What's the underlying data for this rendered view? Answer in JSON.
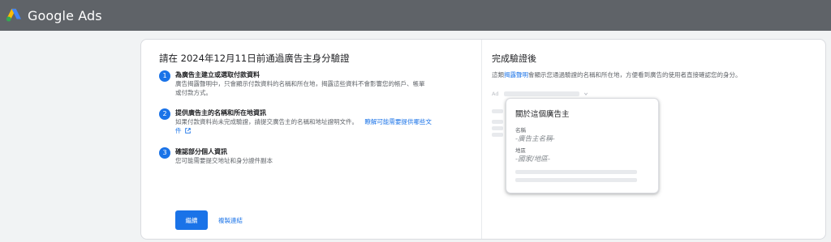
{
  "header": {
    "app_name": "Google Ads",
    "logo_icon": "google-ads-logo",
    "background": "#5f6368"
  },
  "left": {
    "title": "請在 2024年12月11日前通過廣告主身分驗證",
    "steps": [
      {
        "number": "1",
        "title": "為廣告主建立或選取付款資料",
        "desc_line1": "廣告揭露聲明中，只會顯示付款資料的名稱和所在地，揭露這些資料不會影響您的帳戶、帳單",
        "desc_line2": "或付款方式。"
      },
      {
        "number": "2",
        "title": "提供廣告主的名稱和所在地資訊",
        "desc": "如果付款資料尚未完成驗證，請提交廣告主的名稱和地址證明文件。",
        "link_line1": "瞭解可能需要提供哪些文",
        "link_line2": "件",
        "link_icon": "external-link-icon"
      },
      {
        "number": "3",
        "title": "確認部分個人資訊",
        "desc": "您可能需要提交地址和身分證件副本"
      }
    ],
    "continue_label": "繼續",
    "copy_link_label": "複製連結"
  },
  "right": {
    "title": "完成驗證後",
    "desc_prefix": "這類",
    "desc_link": "揭露聲明",
    "desc_suffix": "會顯示您通過驗證的名稱和所在地，方便看到廣告的使用者直接確認您的身分。",
    "ad_label": "Ad",
    "popup": {
      "title": "關於這個廣告主",
      "name_label": "名稱",
      "name_value": "-廣告主名稱-",
      "region_label": "地區",
      "region_value": "-國家/地區-"
    }
  },
  "colors": {
    "accent": "#1a73e8",
    "placeholder_bar": "#e8eaed",
    "page_background": "#f1f3f4"
  }
}
